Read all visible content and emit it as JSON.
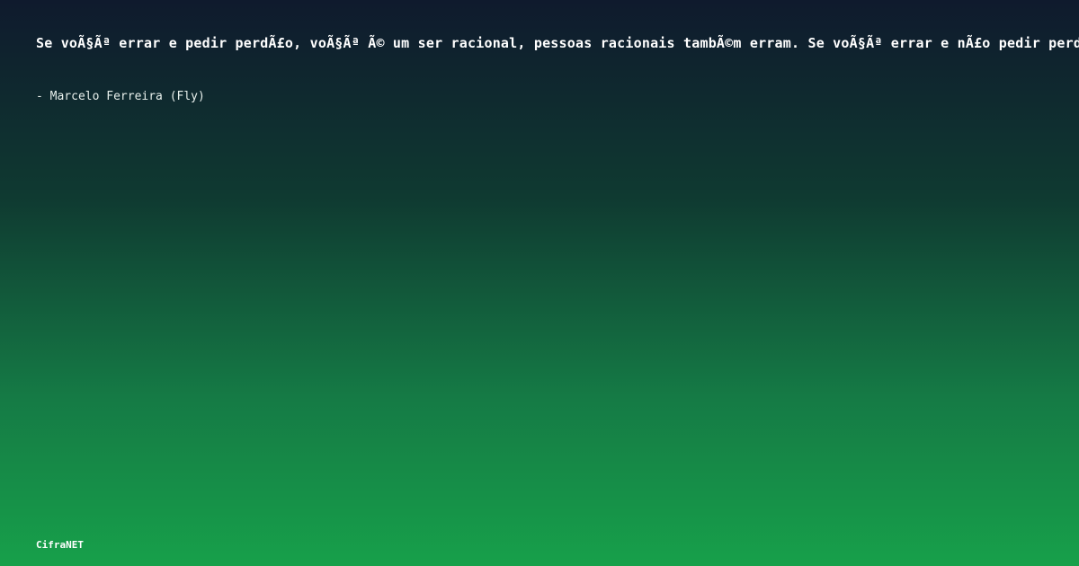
{
  "quote": {
    "text": "Se voÃ§Ãª errar e pedir perdÃ£o, voÃ§Ãª Ã© um ser racional, pessoas racionais tambÃ©m erram. Se voÃ§Ãª errar e nÃ£o pedir perdÃ£o"
  },
  "author": {
    "text": "- Marcelo Ferreira (Fly)"
  },
  "brand": {
    "name": "CifraNET"
  }
}
